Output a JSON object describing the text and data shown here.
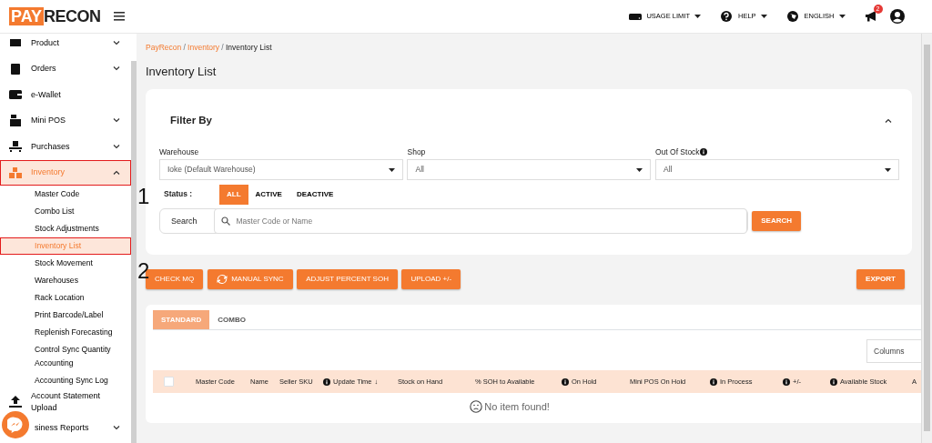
{
  "header": {
    "logo_left": "PAY",
    "logo_right": "RECON",
    "actions": [
      {
        "kind": "usage",
        "label": "USAGE LIMIT"
      },
      {
        "kind": "help",
        "label": "HELP"
      },
      {
        "kind": "language",
        "label": "ENGLISH"
      }
    ],
    "notifications": {
      "count": "2"
    }
  },
  "sidebar": {
    "items": [
      {
        "kind": "product",
        "label": "Product",
        "has_caret": true,
        "expanded": false,
        "selected": false,
        "highlighted": false
      },
      {
        "kind": "orders",
        "label": "Orders",
        "has_caret": true,
        "expanded": false,
        "selected": false,
        "highlighted": false
      },
      {
        "kind": "wallet",
        "label": "e-Wallet",
        "has_caret": false,
        "selected": false,
        "highlighted": false
      },
      {
        "kind": "pos",
        "label": "Mini POS",
        "has_caret": true,
        "expanded": false,
        "selected": false,
        "highlighted": false
      },
      {
        "kind": "purchases",
        "label": "Purchases",
        "has_caret": true,
        "expanded": false,
        "selected": false,
        "highlighted": false
      },
      {
        "kind": "inventory",
        "label": "Inventory",
        "has_caret": true,
        "expanded": true,
        "selected": true,
        "highlighted": true,
        "children": [
          {
            "label": "Master Code",
            "selected": false,
            "highlighted": false
          },
          {
            "label": "Combo List",
            "selected": false,
            "highlighted": false
          },
          {
            "label": "Stock Adjustments",
            "selected": false,
            "highlighted": false
          },
          {
            "label": "Inventory List",
            "selected": true,
            "highlighted": true
          },
          {
            "label": "Stock Movement",
            "selected": false,
            "highlighted": false
          },
          {
            "label": "Warehouses",
            "selected": false,
            "highlighted": false
          },
          {
            "label": "Rack Location",
            "selected": false,
            "highlighted": false
          },
          {
            "label": "Print Barcode/Label",
            "selected": false,
            "highlighted": false
          },
          {
            "label": "Replenish Forecasting",
            "selected": false,
            "highlighted": false
          },
          {
            "label": "Control Sync Quantity Accounting",
            "selected": false,
            "highlighted": false
          },
          {
            "label": "Accounting Sync Log",
            "selected": false,
            "highlighted": false
          }
        ]
      },
      {
        "kind": "upload",
        "label": "Account Statement Upload",
        "has_caret": false,
        "selected": false,
        "highlighted": false
      },
      {
        "kind": "reports",
        "label": "siness Reports",
        "has_caret": true,
        "expanded": false,
        "selected": false,
        "highlighted": false
      }
    ]
  },
  "breadcrumb_separator": "/",
  "breadcrumb": [
    {
      "label": "PayRecon",
      "link": true
    },
    {
      "label": "Inventory",
      "link": true
    },
    {
      "label": "Inventory List",
      "link": false
    }
  ],
  "page_title": "Inventory List",
  "annotations": [
    "1",
    "2"
  ],
  "filter": {
    "title": "Filter By",
    "expanded": true,
    "fields": [
      {
        "label": "Warehouse",
        "value": "Ioke (Default Warehouse)",
        "info": false
      },
      {
        "label": "Shop",
        "value": "All",
        "info": false
      },
      {
        "label": "Out Of Stock",
        "value": "All",
        "info": true
      }
    ],
    "status_label": "Status :",
    "status_options": [
      {
        "label": "ALL",
        "selected": true
      },
      {
        "label": "ACTIVE",
        "selected": false
      },
      {
        "label": "DEACTIVE",
        "selected": false
      }
    ],
    "search_label": "Search",
    "search_placeholder": "Master Code or Name",
    "search_button": "SEARCH"
  },
  "actions": [
    {
      "label": "CHECK MQ",
      "icon": false
    },
    {
      "label": "MANUAL SYNC",
      "icon": true
    },
    {
      "label": "ADJUST PERCENT SOH",
      "icon": false
    },
    {
      "label": "UPLOAD +/-",
      "icon": false
    }
  ],
  "export_button": "EXPORT",
  "tabs": [
    {
      "label": "STANDARD",
      "selected": true
    },
    {
      "label": "COMBO",
      "selected": false
    }
  ],
  "columns_placeholder": "Columns",
  "table": {
    "select_all": {
      "checked": false
    },
    "columns": [
      {
        "label": "Master Code",
        "info": false
      },
      {
        "label": "Name",
        "info": false
      },
      {
        "label": "Seller SKU",
        "info": false
      },
      {
        "label": "Update Time",
        "info": true,
        "sort_indicator": "↓"
      },
      {
        "label": "Stock on Hand",
        "info": false
      },
      {
        "label": "% SOH to Available",
        "info": false
      },
      {
        "label": "On Hold",
        "info": true
      },
      {
        "label": "Mini POS On Hold",
        "info": false
      },
      {
        "label": "In Process",
        "info": true
      },
      {
        "label": "+/-",
        "info": true
      },
      {
        "label": "Available Stock",
        "info": true
      },
      {
        "label": "A",
        "info": false
      }
    ],
    "empty_text": "No item found!"
  }
}
